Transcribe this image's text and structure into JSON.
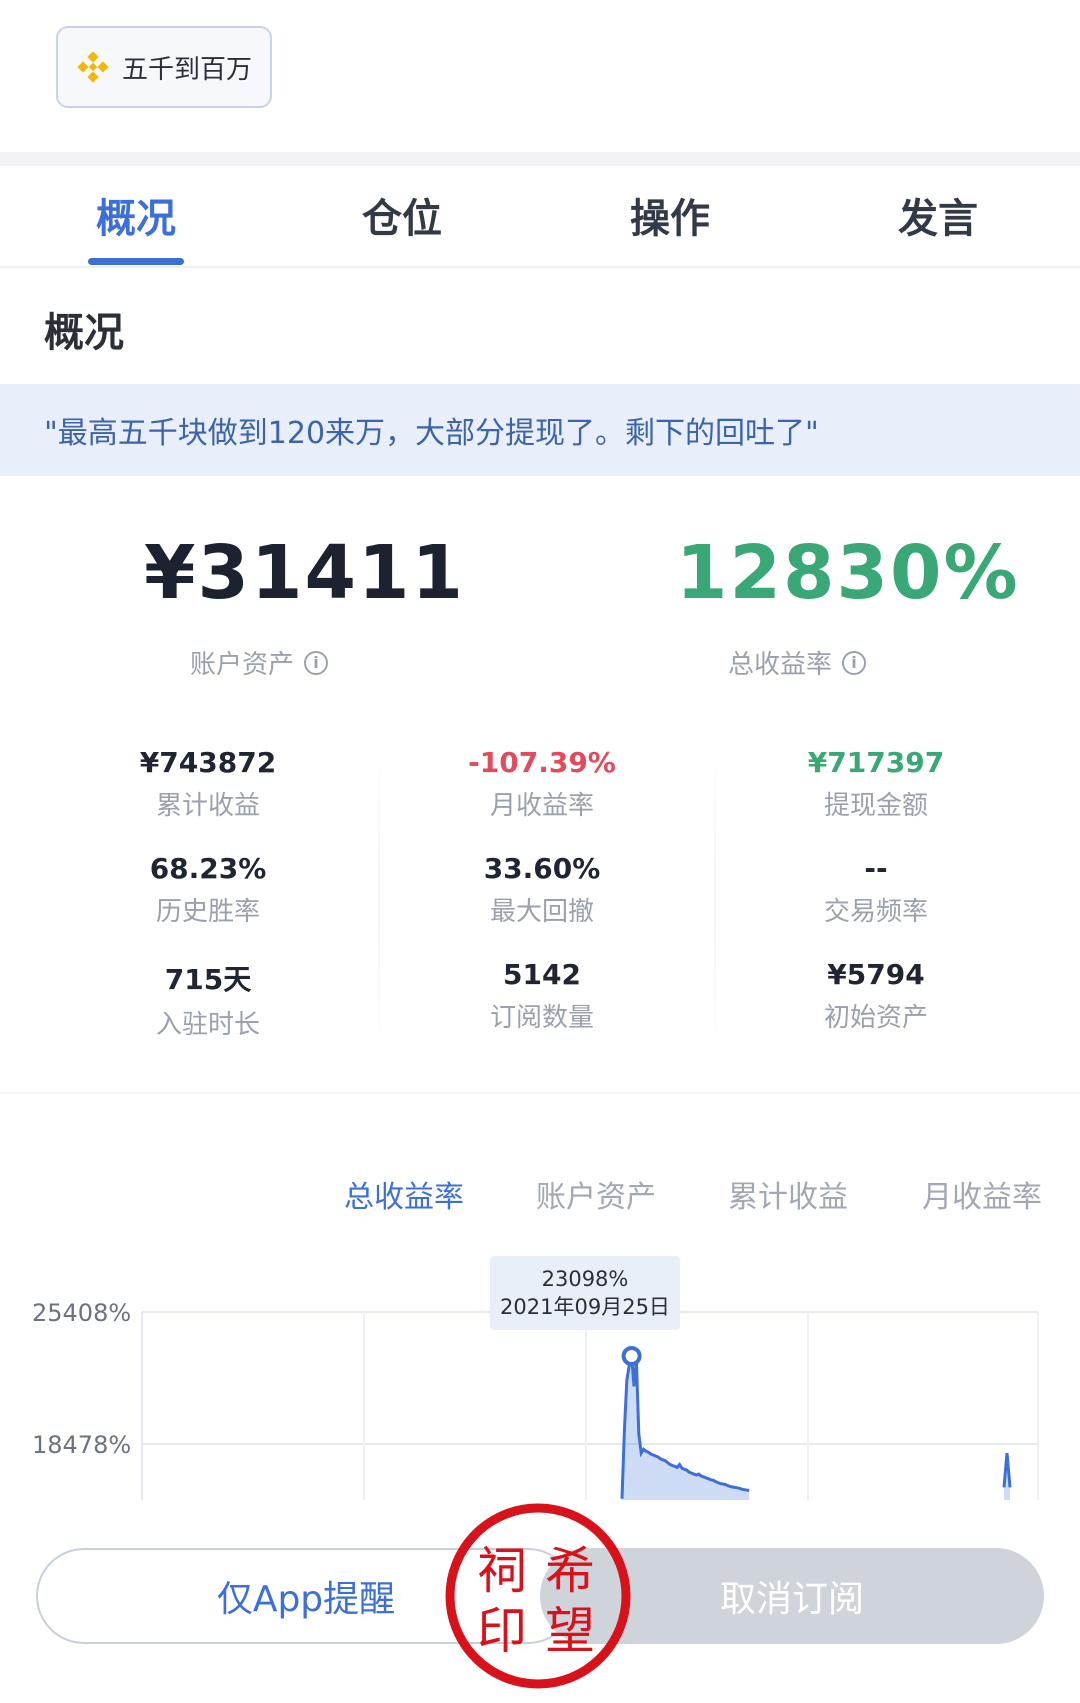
{
  "header": {
    "brand_label": "五千到百万"
  },
  "tabs": [
    {
      "label": "概况",
      "active": true
    },
    {
      "label": "仓位",
      "active": false
    },
    {
      "label": "操作",
      "active": false
    },
    {
      "label": "发言",
      "active": false
    }
  ],
  "section_title": "概况",
  "quote": "\"最高五千块做到120来万，大部分提现了。剩下的回吐了\"",
  "summary": {
    "assets_value": "¥31411",
    "assets_label": "账户资产",
    "rate_value": "12830%",
    "rate_label": "总收益率",
    "info_glyph": "i"
  },
  "stats": [
    {
      "value": "¥743872",
      "label": "累计收益",
      "tone": "normal"
    },
    {
      "value": "-107.39%",
      "label": "月收益率",
      "tone": "neg"
    },
    {
      "value": "¥717397",
      "label": "提现金额",
      "tone": "pos"
    },
    {
      "value": "68.23%",
      "label": "历史胜率",
      "tone": "normal"
    },
    {
      "value": "33.60%",
      "label": "最大回撤",
      "tone": "normal"
    },
    {
      "value": "--",
      "label": "交易频率",
      "tone": "normal"
    },
    {
      "value": "715天",
      "label": "入驻时长",
      "tone": "normal"
    },
    {
      "value": "5142",
      "label": "订阅数量",
      "tone": "normal"
    },
    {
      "value": "¥5794",
      "label": "初始资产",
      "tone": "normal"
    }
  ],
  "chart_tabs": [
    {
      "label": "总收益率",
      "active": true
    },
    {
      "label": "账户资产",
      "active": false
    },
    {
      "label": "累计收益",
      "active": false
    },
    {
      "label": "月收益率",
      "active": false
    }
  ],
  "chart_data": {
    "type": "area",
    "y_tick_labels": [
      "25408%",
      "18478%"
    ],
    "y_ticks": [
      25408,
      18478
    ],
    "tooltip": {
      "value": "23098%",
      "date": "2021年09月25日"
    },
    "series": [
      {
        "color": "#3d6fd9",
        "values": [
          null,
          null,
          null,
          null,
          null,
          null,
          null,
          null,
          null,
          null,
          null,
          null,
          null,
          null,
          null,
          null,
          null,
          null,
          null,
          null,
          null,
          null,
          null,
          null,
          null,
          null,
          null,
          null,
          null,
          null,
          null,
          null,
          null,
          null,
          null,
          null,
          null,
          null,
          null,
          null,
          null,
          null,
          null,
          null,
          null,
          null,
          null,
          null,
          null,
          null,
          null,
          null,
          null,
          null,
          null,
          null,
          null,
          null,
          null,
          null,
          null,
          null,
          null,
          null,
          null,
          null,
          null,
          null,
          null,
          null,
          null,
          null,
          null,
          null,
          null,
          null,
          15600,
          19200,
          21800,
          22600,
          23098,
          21500,
          22900,
          19000,
          18000,
          18200,
          18100,
          18050,
          17950,
          17900,
          17850,
          17800,
          17700,
          17650,
          17600,
          17500,
          17400,
          17350,
          17300,
          17250,
          17400,
          17200,
          17150,
          17100,
          17000,
          16950,
          16900,
          16850,
          16900,
          16800,
          16750,
          16700,
          16650,
          16600,
          16580,
          16500,
          16450,
          16400,
          16380,
          16350,
          16300,
          16250,
          16220,
          16200,
          16180,
          16150,
          16100,
          16080,
          16060,
          16050,
          null,
          null,
          null,
          null,
          null,
          null,
          null,
          null,
          null,
          null,
          null,
          null,
          null,
          null,
          null,
          null,
          null,
          null,
          null,
          null,
          null,
          null,
          null,
          null,
          null,
          null,
          null,
          null,
          null,
          null,
          null,
          null,
          null,
          null,
          null,
          null,
          null,
          null,
          null,
          null,
          null,
          null,
          null,
          null,
          null,
          null,
          null,
          null,
          null,
          null,
          null,
          null,
          null,
          null,
          null,
          null,
          null,
          null,
          null,
          null,
          null,
          null,
          null,
          null,
          16200,
          18000,
          16200
        ]
      }
    ]
  },
  "buttons": {
    "app_only": "仅App提醒",
    "unsubscribe": "取消订阅"
  },
  "seal": {
    "chars": [
      "祠",
      "希",
      "印",
      "望"
    ]
  },
  "colors": {
    "accent": "#3d6fd9",
    "positive": "#3aa876",
    "negative": "#e24b5c"
  }
}
